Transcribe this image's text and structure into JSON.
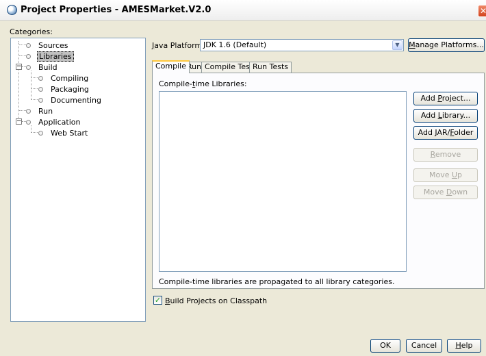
{
  "window": {
    "title": "Project Properties - AMESMarket.V2.0",
    "close_icon": "close-icon"
  },
  "categories": {
    "label": "Categories:",
    "items": [
      {
        "label": "Sources"
      },
      {
        "label": "Libraries",
        "selected": true
      },
      {
        "label": "Build"
      },
      {
        "label": "Compiling"
      },
      {
        "label": "Packaging"
      },
      {
        "label": "Documenting"
      },
      {
        "label": "Run"
      },
      {
        "label": "Application"
      },
      {
        "label": "Web Start"
      }
    ]
  },
  "platform": {
    "label_mnemonic": "J",
    "label_rest": "ava Platform:",
    "value": "JDK 1.6 (Default)",
    "manage_mnemonic": "M",
    "manage_rest": "anage Platforms..."
  },
  "tabs": [
    {
      "label": "Compile",
      "active": true
    },
    {
      "label": "Run"
    },
    {
      "label": "Compile Tests"
    },
    {
      "label": "Run Tests"
    }
  ],
  "compile": {
    "list_label_pre": "Compile-",
    "list_label_mnemonic": "t",
    "list_label_post": "ime Libraries:",
    "footer_note": "Compile-time libraries are propagated to all library categories.",
    "build_projects_pre": "",
    "build_projects_mnemonic": "B",
    "build_projects_post": "uild Projects on Classpath",
    "build_projects_checked": true
  },
  "buttons": {
    "add_project_pre": "Add ",
    "add_project_mnemonic": "P",
    "add_project_post": "roject...",
    "add_library_pre": "Add ",
    "add_library_mnemonic": "L",
    "add_library_post": "ibrary...",
    "add_jar_pre": "Add JAR/",
    "add_jar_mnemonic": "F",
    "add_jar_post": "older",
    "remove_mnemonic": "R",
    "remove_post": "emove",
    "move_up_pre": "Move ",
    "move_up_mnemonic": "U",
    "move_up_post": "p",
    "move_down_pre": "Move ",
    "move_down_mnemonic": "D",
    "move_down_post": "own",
    "ok": "OK",
    "cancel": "Cancel",
    "help_mnemonic": "H",
    "help_post": "elp"
  },
  "colors": {
    "dialog_bg": "#ece9d8",
    "active_tab_accent": "#ffc83c",
    "button_border": "#003c74",
    "close_button": "#d2441e"
  }
}
